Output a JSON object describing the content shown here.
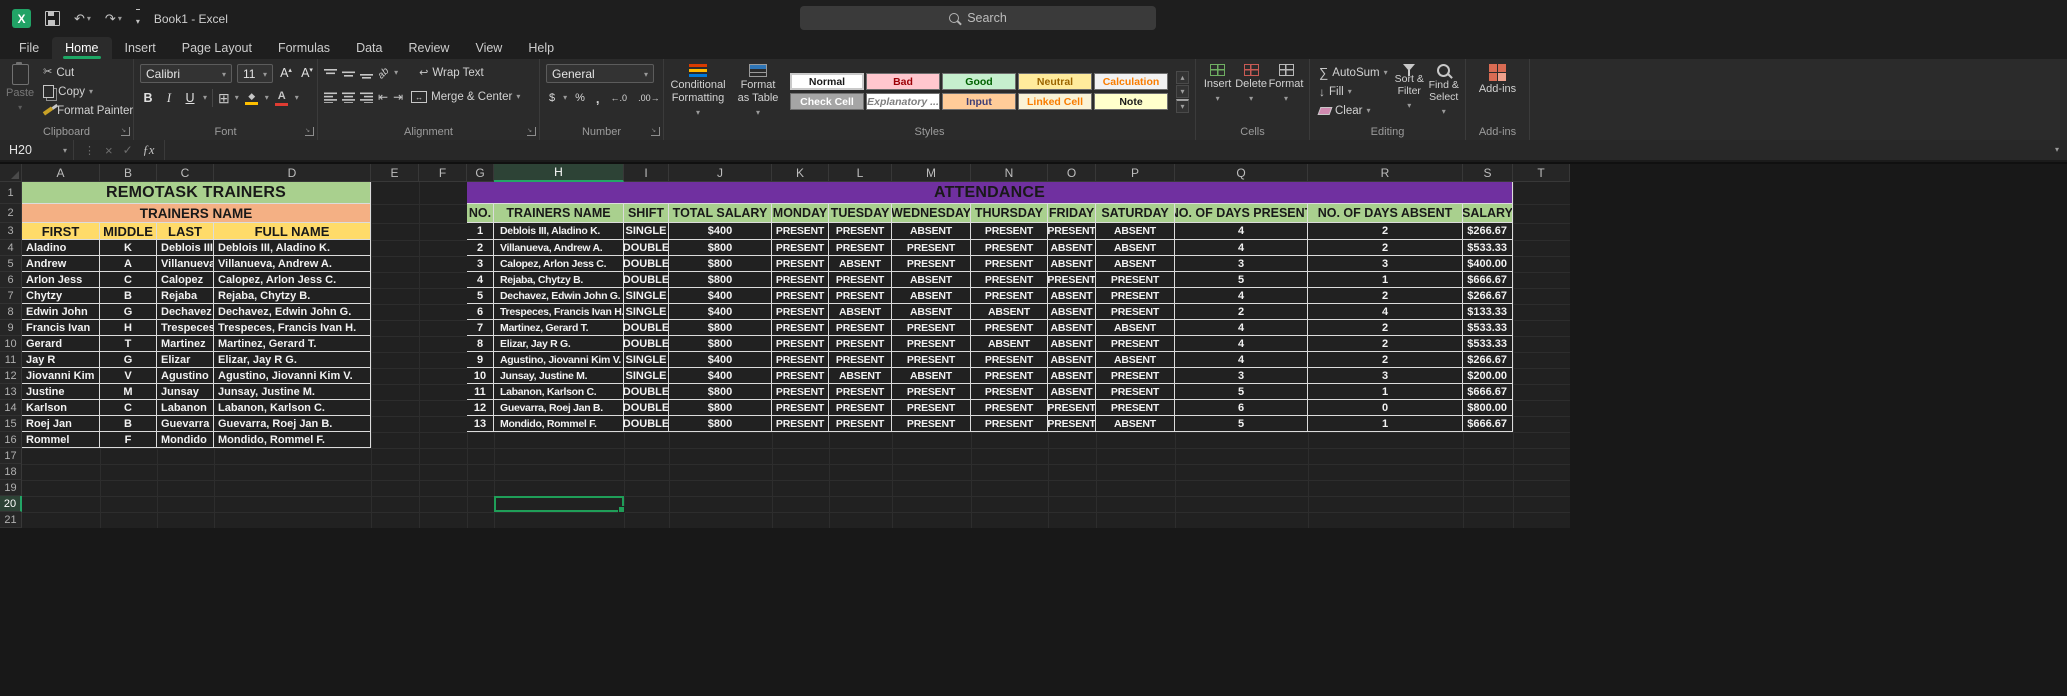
{
  "titlebar": {
    "title": "Book1 - Excel",
    "search_placeholder": "Search"
  },
  "icons": {
    "excel_logo": "green square with X",
    "save": "floppy",
    "undo": "↶",
    "redo": "↷",
    "dropdown": "▾",
    "collapse_ribbon": "▴",
    "cancel": "×",
    "enter": "✓",
    "function": "ƒx",
    "autosum": "∑",
    "borders": "⊞",
    "fill_bucket": "◆",
    "font_color_letter": "A",
    "fill_arrow": "↓",
    "wrap_return": "↩",
    "merge_arrows": "↔",
    "orientation": "ab",
    "indent_decrease": "⇤",
    "indent_increase": "⇥",
    "increase_font": "A▴",
    "decrease_font": "A▾",
    "fill_color_bar": "#FFC000",
    "font_color_bar": "#E03C32"
  },
  "ribbon": {
    "tabs": [
      "File",
      "Home",
      "Insert",
      "Page Layout",
      "Formulas",
      "Data",
      "Review",
      "View",
      "Help"
    ],
    "active_tab": "Home",
    "clipboard": {
      "group_label": "Clipboard",
      "paste": "Paste",
      "cut": "Cut",
      "copy": "Copy",
      "format_painter": "Format Painter"
    },
    "font": {
      "group_label": "Font",
      "font_name": "Calibri",
      "font_size": "11",
      "bold": "B",
      "italic": "I",
      "underline": "U"
    },
    "alignment": {
      "group_label": "Alignment",
      "wrap_text": "Wrap Text",
      "merge_center": "Merge & Center"
    },
    "number": {
      "group_label": "Number",
      "format": "General",
      "accounting": "$",
      "percent": "%",
      "comma": ",",
      "increase_decimal": "←.0",
      "decrease_decimal": ".00→"
    },
    "styles": {
      "group_label": "Styles",
      "conditional_formatting": "Conditional Formatting",
      "format_as_table": "Format as Table",
      "gallery": [
        {
          "label": "Normal",
          "bg": "#FFFFFF",
          "fg": "#1A1A1A",
          "selected": true
        },
        {
          "label": "Bad",
          "bg": "#FFC7CE",
          "fg": "#9C0006"
        },
        {
          "label": "Good",
          "bg": "#C6EFCE",
          "fg": "#006100"
        },
        {
          "label": "Neutral",
          "bg": "#FFEB9C",
          "fg": "#9C6500"
        },
        {
          "label": "Calculation",
          "bg": "#F2F2F2",
          "fg": "#FA7D00"
        },
        {
          "label": "Check Cell",
          "bg": "#A5A5A5",
          "fg": "#FFFFFF"
        },
        {
          "label": "Explanatory ...",
          "bg": "#FFFFFF",
          "fg": "#7F7F7F",
          "italic": true
        },
        {
          "label": "Input",
          "bg": "#FFCC99",
          "fg": "#3F3F76"
        },
        {
          "label": "Linked Cell",
          "bg": "#FBF3D5",
          "fg": "#FA7D00"
        },
        {
          "label": "Note",
          "bg": "#FFFFCC",
          "fg": "#1A1A1A"
        }
      ]
    },
    "cells": {
      "group_label": "Cells",
      "insert": "Insert",
      "delete": "Delete",
      "format": "Format"
    },
    "editing": {
      "group_label": "Editing",
      "autosum": "AutoSum",
      "fill": "Fill",
      "clear": "Clear",
      "sort_filter": "Sort & Filter",
      "find_select": "Find & Select"
    },
    "addins": {
      "group_label": "Add-ins",
      "button": "Add-ins"
    }
  },
  "formula_bar": {
    "name_box": "H20",
    "formula": ""
  },
  "sheet": {
    "selected_cell": "H20",
    "columns": [
      "A",
      "B",
      "C",
      "D",
      "E",
      "F",
      "G",
      "H",
      "I",
      "J",
      "K",
      "L",
      "M",
      "N",
      "O",
      "P",
      "Q",
      "R",
      "S",
      "T"
    ],
    "row_count": 21,
    "colors": {
      "green_header": "#A9D08E",
      "orange_header": "#F4B084",
      "yellow_header": "#FFDB69",
      "purple_header": "#7030A0",
      "accent_green": "#1EA765"
    },
    "trainers_table": {
      "title": "REMOTASK TRAINERS",
      "subtitle": "TRAINERS NAME",
      "headers": [
        "FIRST",
        "MIDDLE",
        "LAST",
        "FULL NAME"
      ],
      "rows": [
        [
          "Aladino",
          "K",
          "Deblois III",
          "Deblois III, Aladino K."
        ],
        [
          "Andrew",
          "A",
          "Villanueva",
          "Villanueva, Andrew A."
        ],
        [
          "Arlon Jess",
          "C",
          "Calopez",
          "Calopez, Arlon Jess C."
        ],
        [
          "Chytzy",
          "B",
          "Rejaba",
          "Rejaba, Chytzy B."
        ],
        [
          "Edwin John",
          "G",
          "Dechavez",
          "Dechavez, Edwin John G."
        ],
        [
          "Francis Ivan",
          "H",
          "Trespeces",
          "Trespeces, Francis Ivan H."
        ],
        [
          "Gerard",
          "T",
          "Martinez",
          "Martinez, Gerard T."
        ],
        [
          "Jay R",
          "G",
          "Elizar",
          "Elizar, Jay R G."
        ],
        [
          "Jiovanni Kim",
          "V",
          "Agustino",
          "Agustino, Jiovanni Kim V."
        ],
        [
          "Justine",
          "M",
          "Junsay",
          "Junsay, Justine M."
        ],
        [
          "Karlson",
          "C",
          "Labanon",
          "Labanon, Karlson C."
        ],
        [
          "Roej Jan",
          "B",
          "Guevarra",
          "Guevarra, Roej Jan B."
        ],
        [
          "Rommel",
          "F",
          "Mondido",
          "Mondido, Rommel F."
        ]
      ]
    },
    "attendance_table": {
      "title": "ATTENDANCE",
      "headers": [
        "NO.",
        "TRAINERS NAME",
        "SHIFT",
        "TOTAL SALARY",
        "MONDAY",
        "TUESDAY",
        "WEDNESDAY",
        "THURSDAY",
        "FRIDAY",
        "SATURDAY",
        "NO. OF DAYS PRESENT",
        "NO. OF DAYS ABSENT",
        "SALARY"
      ],
      "rows": [
        [
          1,
          "Deblois III, Aladino K.",
          "SINGLE",
          "$400",
          "PRESENT",
          "PRESENT",
          "ABSENT",
          "PRESENT",
          "PRESENT",
          "ABSENT",
          4,
          2,
          "$266.67"
        ],
        [
          2,
          "Villanueva, Andrew A.",
          "DOUBLE",
          "$800",
          "PRESENT",
          "PRESENT",
          "PRESENT",
          "PRESENT",
          "ABSENT",
          "ABSENT",
          4,
          2,
          "$533.33"
        ],
        [
          3,
          "Calopez, Arlon Jess C.",
          "DOUBLE",
          "$800",
          "PRESENT",
          "ABSENT",
          "PRESENT",
          "PRESENT",
          "ABSENT",
          "ABSENT",
          3,
          3,
          "$400.00"
        ],
        [
          4,
          "Rejaba, Chytzy B.",
          "DOUBLE",
          "$800",
          "PRESENT",
          "PRESENT",
          "ABSENT",
          "PRESENT",
          "PRESENT",
          "PRESENT",
          5,
          1,
          "$666.67"
        ],
        [
          5,
          "Dechavez, Edwin John G.",
          "SINGLE",
          "$400",
          "PRESENT",
          "PRESENT",
          "ABSENT",
          "PRESENT",
          "ABSENT",
          "PRESENT",
          4,
          2,
          "$266.67"
        ],
        [
          6,
          "Trespeces, Francis Ivan H.",
          "SINGLE",
          "$400",
          "PRESENT",
          "ABSENT",
          "ABSENT",
          "ABSENT",
          "ABSENT",
          "PRESENT",
          2,
          4,
          "$133.33"
        ],
        [
          7,
          "Martinez, Gerard T.",
          "DOUBLE",
          "$800",
          "PRESENT",
          "PRESENT",
          "PRESENT",
          "PRESENT",
          "ABSENT",
          "ABSENT",
          4,
          2,
          "$533.33"
        ],
        [
          8,
          "Elizar, Jay R G.",
          "DOUBLE",
          "$800",
          "PRESENT",
          "PRESENT",
          "PRESENT",
          "ABSENT",
          "ABSENT",
          "PRESENT",
          4,
          2,
          "$533.33"
        ],
        [
          9,
          "Agustino, Jiovanni Kim V.",
          "SINGLE",
          "$400",
          "PRESENT",
          "PRESENT",
          "PRESENT",
          "PRESENT",
          "ABSENT",
          "ABSENT",
          4,
          2,
          "$266.67"
        ],
        [
          10,
          "Junsay, Justine M.",
          "SINGLE",
          "$400",
          "PRESENT",
          "ABSENT",
          "ABSENT",
          "PRESENT",
          "ABSENT",
          "PRESENT",
          3,
          3,
          "$200.00"
        ],
        [
          11,
          "Labanon, Karlson C.",
          "DOUBLE",
          "$800",
          "PRESENT",
          "PRESENT",
          "PRESENT",
          "PRESENT",
          "ABSENT",
          "PRESENT",
          5,
          1,
          "$666.67"
        ],
        [
          12,
          "Guevarra, Roej Jan B.",
          "DOUBLE",
          "$800",
          "PRESENT",
          "PRESENT",
          "PRESENT",
          "PRESENT",
          "PRESENT",
          "PRESENT",
          6,
          0,
          "$800.00"
        ],
        [
          13,
          "Mondido, Rommel F.",
          "DOUBLE",
          "$800",
          "PRESENT",
          "PRESENT",
          "PRESENT",
          "PRESENT",
          "PRESENT",
          "ABSENT",
          5,
          1,
          "$666.67"
        ]
      ]
    }
  }
}
